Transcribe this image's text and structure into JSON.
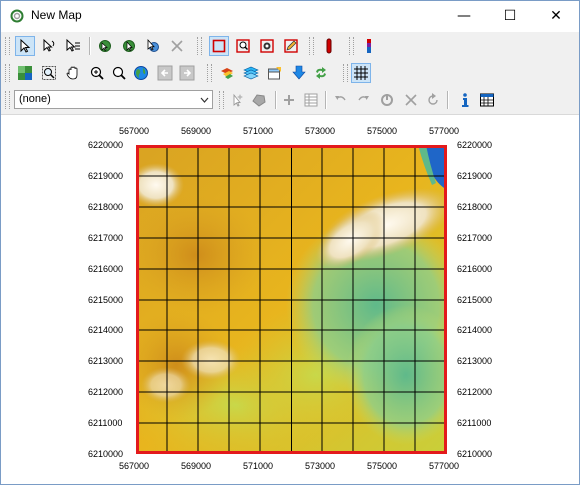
{
  "window": {
    "title": "New Map",
    "minimize_glyph": "—",
    "maximize_glyph": "☐",
    "close_glyph": "✕"
  },
  "toolbar": {
    "layer_select": {
      "value": "(none)"
    },
    "row1_icons": [
      "select-arrow-icon",
      "select-by-point-icon",
      "select-by-rect-icon",
      "refresh-select-icon",
      "select-move-icon",
      "select-edit-icon",
      "delete-cross-icon",
      "rectangle-tool-icon",
      "zoom-rect-icon",
      "gear-frame-icon",
      "pencil-frame-icon",
      "red-marker-icon",
      "multicolor-marker-icon"
    ],
    "row2_icons": [
      "layer-select-icon",
      "zoom-window-icon",
      "pan-hand-icon",
      "zoom-in-icon",
      "zoom-out-icon",
      "globe-icon",
      "back-arrow-icon",
      "forward-arrow-icon",
      "map-color-icon",
      "layers-stack-icon",
      "layer-properties-icon",
      "add-down-icon",
      "sync-arrows-icon",
      "grid-icon"
    ],
    "row3_icons": [
      "cursor-sparkle-icon",
      "polygon-tool-icon",
      "add-point-icon",
      "table-add-icon",
      "undo-icon",
      "redo-icon",
      "rotate-icon",
      "cross-cancel-icon",
      "reset-icon",
      "info-icon",
      "attribute-table-icon"
    ]
  },
  "map": {
    "x_ticks": [
      "567000",
      "569000",
      "571000",
      "573000",
      "575000",
      "577000"
    ],
    "y_ticks": [
      "6220000",
      "6219000",
      "6218000",
      "6217000",
      "6216000",
      "6215000",
      "6214000",
      "6213000",
      "6212000",
      "6211000",
      "6210000"
    ],
    "frame_color": "#e31a1c",
    "grid_color": "#000000"
  }
}
